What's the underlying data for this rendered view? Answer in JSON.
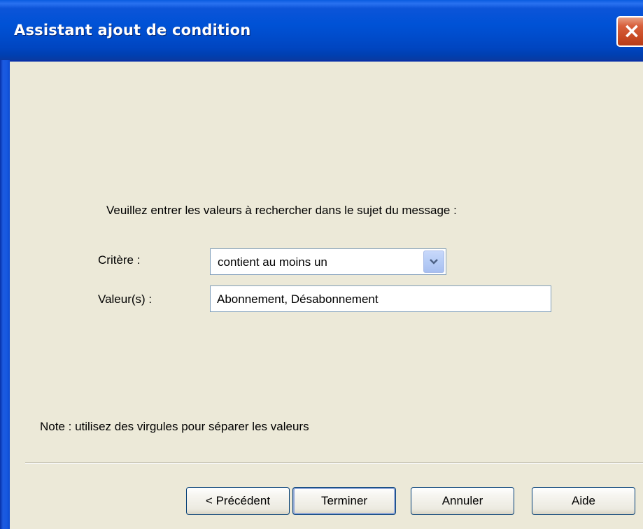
{
  "window": {
    "title": "Assistant ajout de condition"
  },
  "form": {
    "instruction": "Veuillez entrer les valeurs à rechercher dans le sujet du message :",
    "criterion_label": "Critère :",
    "criterion_value": "contient au moins un",
    "values_label": "Valeur(s) :",
    "values_value": "Abonnement, Désabonnement",
    "note": "Note : utilisez des virgules pour séparer les valeurs"
  },
  "buttons": {
    "previous": "< Précédent",
    "finish": "Terminer",
    "cancel": "Annuler",
    "help": "Aide"
  },
  "icons": {
    "close": "close-icon",
    "dropdown": "chevron-down-icon"
  },
  "colors": {
    "titlebar": "#0052d6",
    "close_button": "#d8603c",
    "dialog_background": "#ece9d8"
  }
}
